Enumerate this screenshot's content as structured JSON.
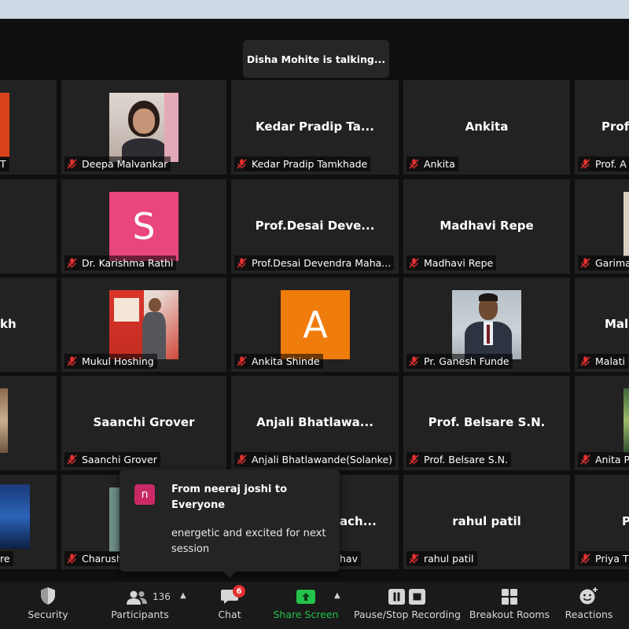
{
  "speaker": {
    "status_text": "Disha Mohite is talking..."
  },
  "tiles": [
    {
      "display_text": "",
      "name": "T"
    },
    {
      "display_text": "",
      "name": "Deepa Malvankar"
    },
    {
      "display_text": "Kedar Pradip Ta...",
      "name": "Kedar Pradip Tamkhade"
    },
    {
      "display_text": "Ankita",
      "name": "Ankita"
    },
    {
      "display_text": "Prof",
      "name": "Prof. A"
    },
    {
      "display_text": "",
      "name": ""
    },
    {
      "display_text": "",
      "name": "Dr. Karishma Rathi",
      "avatar_letter": "S",
      "avatar_color": "#e8467c"
    },
    {
      "display_text": "Prof.Desai  Deve...",
      "name": "Prof.Desai Devendra Maha..."
    },
    {
      "display_text": "Madhavi Repe",
      "name": "Madhavi Repe"
    },
    {
      "display_text": "",
      "name": "Garima"
    },
    {
      "display_text": "kh",
      "name": ""
    },
    {
      "display_text": "",
      "name": "Mukul Hoshing"
    },
    {
      "display_text": "",
      "name": "Ankita Shinde",
      "avatar_letter": "A",
      "avatar_color": "#f07c0c"
    },
    {
      "display_text": "",
      "name": "Pr. Ganesh Funde"
    },
    {
      "display_text": "Mala",
      "name": "Malati"
    },
    {
      "display_text": "",
      "name": ""
    },
    {
      "display_text": "Saanchi Grover",
      "name": "Saanchi Grover"
    },
    {
      "display_text": "Anjali  Bhatlawa...",
      "name": "Anjali Bhatlawande(Solanke)"
    },
    {
      "display_text": "Prof. Belsare S.N.",
      "name": "Prof. Belsare S.N."
    },
    {
      "display_text": "",
      "name": "Anita P"
    },
    {
      "display_text": "",
      "name": "re"
    },
    {
      "display_text": "",
      "name": "Charush"
    },
    {
      "display_text": "ach...",
      "name": "hav"
    },
    {
      "display_text": "rahul patil",
      "name": "rahul patil"
    },
    {
      "display_text": "P",
      "name": "Priya T"
    }
  ],
  "chat_popup": {
    "avatar_letter": "n",
    "from": "From neeraj joshi to Everyone",
    "message": "energetic and excited for next session"
  },
  "toolbar": {
    "security": "Security",
    "participants": "Participants",
    "participant_count": "136",
    "chat": "Chat",
    "chat_badge": "6",
    "share_screen": "Share Screen",
    "recording": "Pause/Stop Recording",
    "breakout": "Breakout Rooms",
    "reactions": "Reactions"
  },
  "colors": {
    "share_green": "#23c24a",
    "badge_red": "#e0302f",
    "mute_red": "#e0302f"
  }
}
